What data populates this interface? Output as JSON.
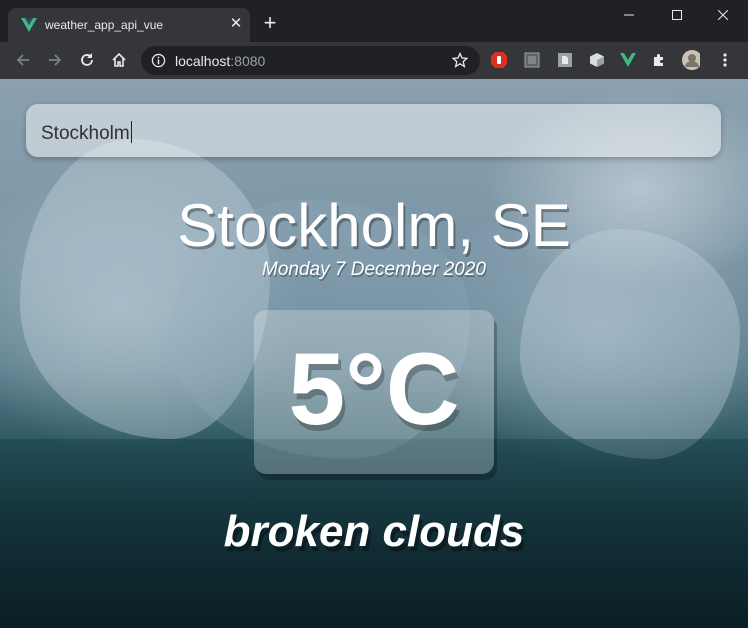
{
  "browser": {
    "tab_title": "weather_app_api_vue",
    "tab_close_glyph": "✕",
    "new_tab_glyph": "+",
    "url_host": "localhost",
    "url_port": ":8080",
    "icons": [
      "vue-favicon-icon",
      "back-icon",
      "forward-icon",
      "reload-icon",
      "home-icon",
      "info-icon",
      "star-icon",
      "extensions-icon",
      "profile-icon",
      "menu-icon"
    ]
  },
  "app": {
    "search": {
      "value": "Stockholm"
    },
    "location": "Stockholm, SE",
    "date": "Monday 7 December 2020",
    "temperature": "5°C",
    "description": "broken clouds"
  },
  "colors": {
    "vue_green": "#41b883",
    "chrome_dark": "#202124",
    "chrome_toolbar": "#35363a"
  }
}
